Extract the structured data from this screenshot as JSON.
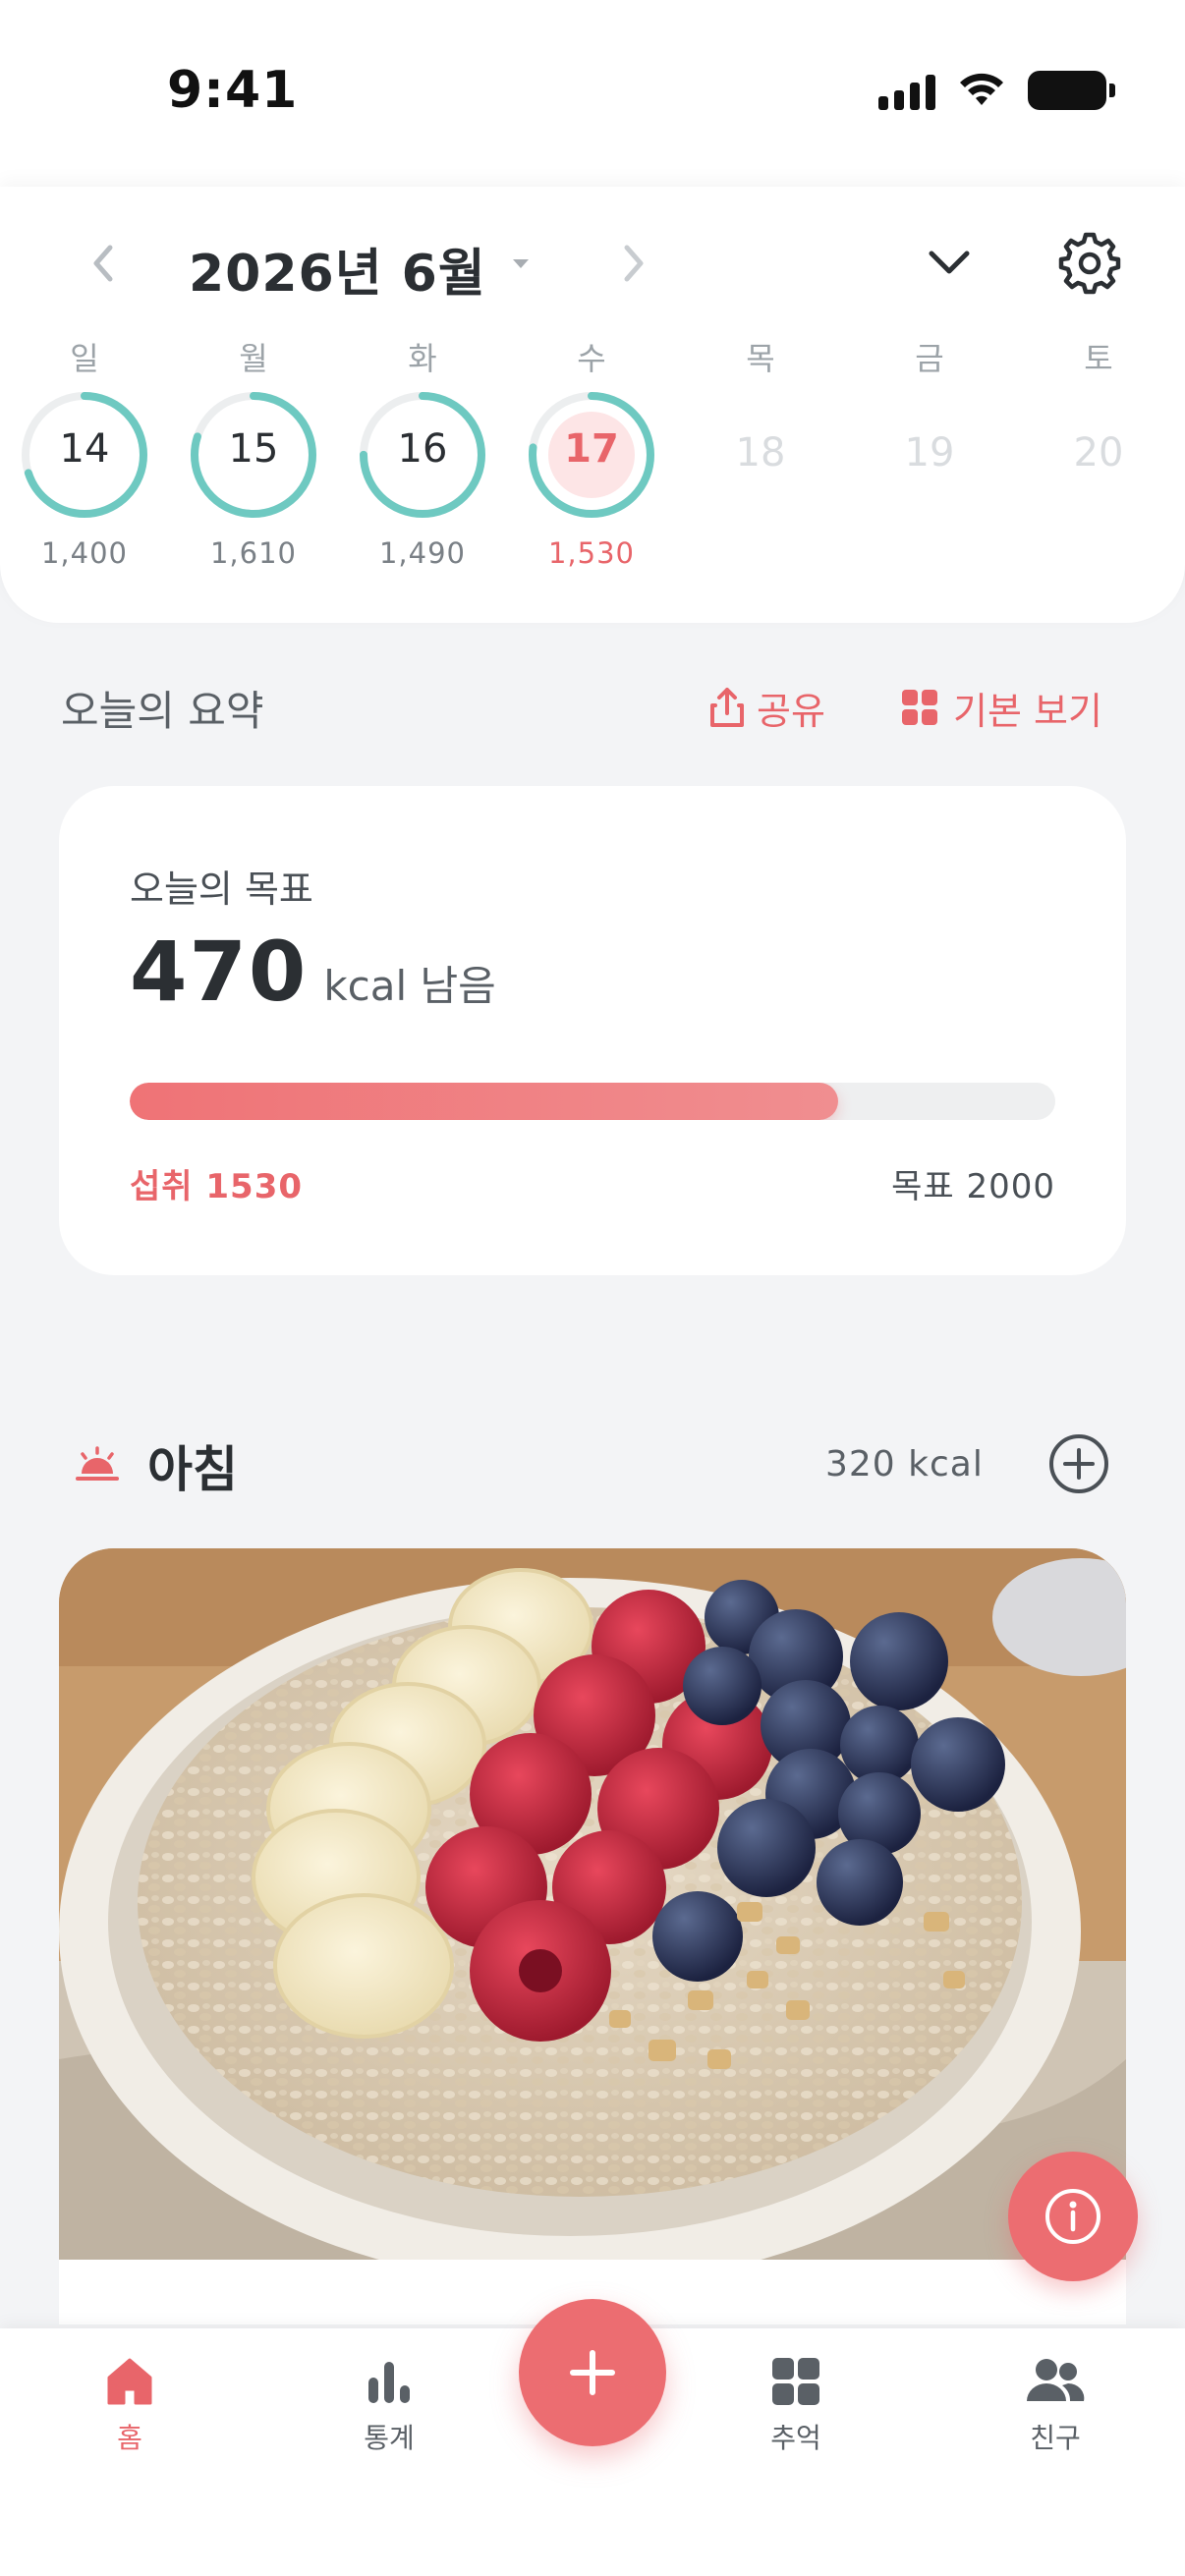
{
  "status_bar": {
    "time": "9:41"
  },
  "calendar": {
    "title": "2026년 6월",
    "weekdays": [
      "일",
      "월",
      "화",
      "수",
      "목",
      "금",
      "토"
    ],
    "days": [
      {
        "num": "14",
        "kcal": "1,400",
        "progress": 0.7
      },
      {
        "num": "15",
        "kcal": "1,610",
        "progress": 0.8
      },
      {
        "num": "16",
        "kcal": "1,490",
        "progress": 0.75
      },
      {
        "num": "17",
        "kcal": "1,530",
        "progress": 0.77
      },
      {
        "num": "18",
        "kcal": ""
      },
      {
        "num": "19",
        "kcal": ""
      },
      {
        "num": "20",
        "kcal": ""
      }
    ]
  },
  "summary": {
    "title": "오늘의 요약",
    "share_label": "공유",
    "view_label": "기본 보기"
  },
  "goal": {
    "label": "오늘의 목표",
    "remaining_value": "470",
    "remaining_unit": "kcal 남음",
    "intake_label": "섭취 1530",
    "target_label": "목표 2000",
    "progress": 0.765
  },
  "meal": {
    "title": "아침",
    "kcal": "320 kcal"
  },
  "nav": {
    "items": [
      {
        "label": "홈"
      },
      {
        "label": "통계"
      },
      {
        "label": "추억"
      },
      {
        "label": "친구"
      }
    ]
  },
  "colors": {
    "accent": "#e8656a",
    "ring": "#6ec9c1"
  }
}
